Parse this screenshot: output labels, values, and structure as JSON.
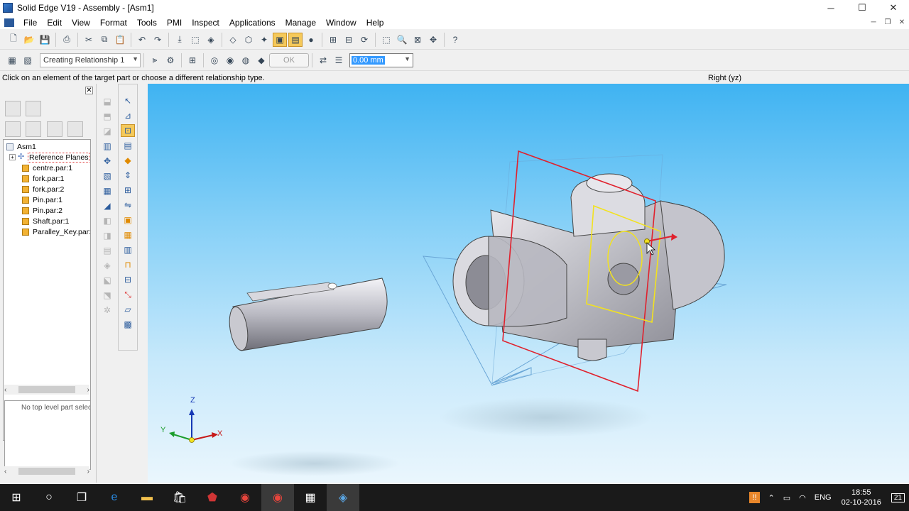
{
  "window": {
    "title": "Solid Edge V19 - Assembly - [Asm1]",
    "controls": [
      "─",
      "☐",
      "✕"
    ]
  },
  "menu": [
    "File",
    "Edit",
    "View",
    "Format",
    "Tools",
    "PMI",
    "Inspect",
    "Applications",
    "Manage",
    "Window",
    "Help"
  ],
  "relationship": {
    "step_combo": "Creating Relationship 1",
    "ok_label": "OK",
    "offset_value": "0.00 mm"
  },
  "prompt": {
    "message": "Click on an element of the target part or choose a different relationship type.",
    "view_name": "Right (yz)"
  },
  "pathfinder": {
    "tree": [
      {
        "label": "Asm1",
        "kind": "assembly"
      },
      {
        "label": "Reference Planes",
        "kind": "planes"
      },
      {
        "label": "centre.par:1",
        "kind": "part"
      },
      {
        "label": "fork.par:1",
        "kind": "part"
      },
      {
        "label": "fork.par:2",
        "kind": "part"
      },
      {
        "label": "Pin.par:1",
        "kind": "part"
      },
      {
        "label": "Pin.par:2",
        "kind": "part"
      },
      {
        "label": "Shaft.par:1",
        "kind": "part"
      },
      {
        "label": "Paralley_Key.par:",
        "kind": "part"
      }
    ],
    "info": "No top level part selec"
  },
  "triad": {
    "z": "Z",
    "y": "Y",
    "x": "X"
  },
  "taskbar": {
    "apps": [
      "start-icon",
      "search-icon",
      "task-view-icon",
      "edge-icon",
      "explorer-icon",
      "store-icon",
      "app-icon",
      "chrome-icon",
      "chrome-icon",
      "app-icon",
      "solid-edge-icon"
    ],
    "language": "ENG",
    "time": "18:55",
    "date": "02-10-2016",
    "notification_count": "21"
  },
  "colors": {
    "highlight": "#f5c95a",
    "plane_red": "#e0212d",
    "plane_yellow": "#f2e21f",
    "plane_blue": "#6aa6d6",
    "viewport_top": "#3fb3f2"
  }
}
